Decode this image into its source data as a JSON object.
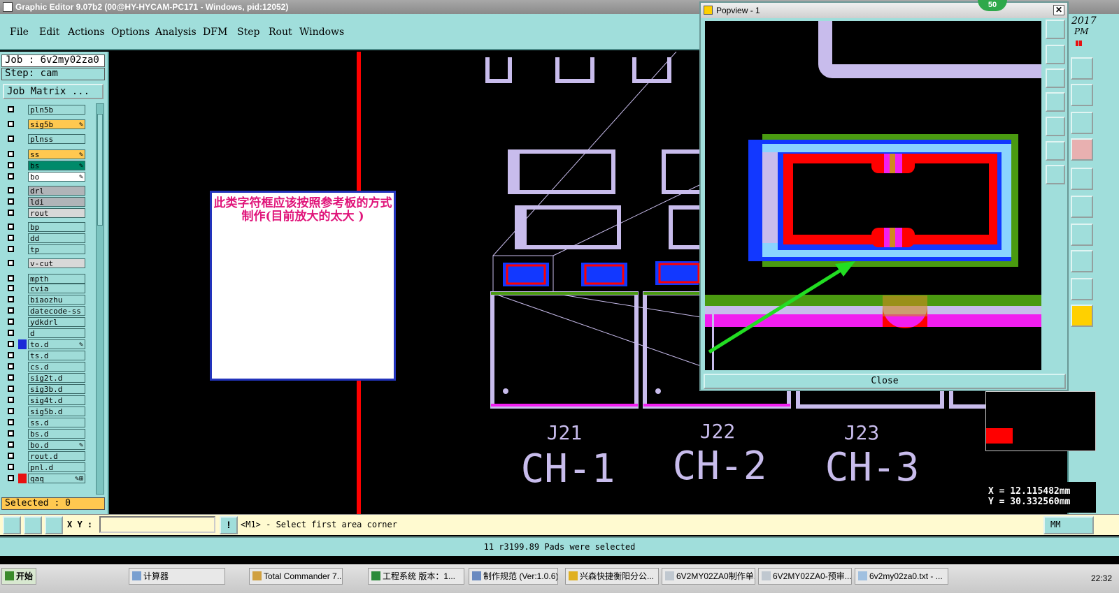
{
  "window": {
    "title": "Graphic Editor 9.07b2 (00@HY-HYCAM-PC171 - Windows, pid:12052)"
  },
  "menu": [
    "File",
    "Edit",
    "Actions",
    "Options",
    "Analysis",
    "DFM",
    "Step",
    "Rout",
    "Windows"
  ],
  "job": {
    "job_label": "Job : 6v2my02za0",
    "step_label": "Step: cam",
    "matrix_button": "Job Matrix ..."
  },
  "layers": [
    {
      "name": "pln5b",
      "color": "#9fdcd8"
    },
    {
      "name": "sig5b",
      "color": "#ffc850",
      "flag": "✎"
    },
    {
      "name": "plnss",
      "color": "#9fdcd8"
    },
    {
      "name": "ss",
      "color": "#ffc850",
      "flag": "✎"
    },
    {
      "name": "bs",
      "color": "#008a6a",
      "flag": "✎"
    },
    {
      "name": "bo",
      "color": "#ffffff",
      "flag": "✎"
    },
    {
      "name": "drl",
      "color": "#b0b4b8"
    },
    {
      "name": "ldi",
      "color": "#b0b4b8"
    },
    {
      "name": "rout",
      "color": "#d8d8d8"
    },
    {
      "name": "bp",
      "color": "#9fdcd8"
    },
    {
      "name": "dd",
      "color": "#9fdcd8"
    },
    {
      "name": "tp",
      "color": "#9fdcd8"
    },
    {
      "name": "v-cut",
      "color": "#d8d8d8"
    },
    {
      "name": "mpth",
      "color": "#9fdcd8"
    },
    {
      "name": "cvia",
      "color": "#9fdcd8"
    },
    {
      "name": "biaozhu",
      "color": "#9fdcd8"
    },
    {
      "name": "datecode-ss",
      "color": "#9fdcd8"
    },
    {
      "name": "ydkdrl",
      "color": "#9fdcd8"
    },
    {
      "name": "d",
      "color": "#9fdcd8"
    },
    {
      "name": "to.d",
      "color": "#9fdcd8",
      "flag": "✎",
      "swatch": "#1a2ad8"
    },
    {
      "name": "ts.d",
      "color": "#9fdcd8"
    },
    {
      "name": "cs.d",
      "color": "#9fdcd8"
    },
    {
      "name": "sig2t.d",
      "color": "#9fdcd8"
    },
    {
      "name": "sig3b.d",
      "color": "#9fdcd8"
    },
    {
      "name": "sig4t.d",
      "color": "#9fdcd8"
    },
    {
      "name": "sig5b.d",
      "color": "#9fdcd8"
    },
    {
      "name": "ss.d",
      "color": "#9fdcd8"
    },
    {
      "name": "bs.d",
      "color": "#9fdcd8"
    },
    {
      "name": "bo.d",
      "color": "#9fdcd8",
      "flag": "✎"
    },
    {
      "name": "rout.d",
      "color": "#9fdcd8"
    },
    {
      "name": "pnl.d",
      "color": "#9fdcd8"
    },
    {
      "name": "qaq",
      "color": "#9fdcd8",
      "flag": "✎⊞",
      "swatch": "#e81010"
    }
  ],
  "selected": "Selected : 0",
  "annotation": {
    "text": "此类字符框应该按照参考板的方式制作(目前放大的太大 )"
  },
  "board_labels": [
    {
      "ref": "J21",
      "ch": "CH-1"
    },
    {
      "ref": "J22",
      "ch": "CH-2"
    },
    {
      "ref": "J23",
      "ch": "CH-3"
    }
  ],
  "popview": {
    "title": "Popview - 1",
    "close": "Close"
  },
  "badge": "50",
  "clock_corner": {
    "year": "2017",
    "ampm": "PM"
  },
  "coords": {
    "x": "X = 12.115482mm",
    "y": "Y = 30.332560mm"
  },
  "units": "MM",
  "xy_label": "X Y :",
  "prompt": "<M1> - Select first area corner",
  "status": "11 r3199.89 Pads were selected",
  "taskbar": {
    "start": "开始",
    "items": [
      "计算器",
      "Total Commander 7....",
      "工程系统  版本：1...",
      "制作规范 (Ver:1.0.6)",
      "兴森快捷衡阳分公...",
      "6V2MY02ZA0制作单...",
      "6V2MY02ZA0-预审...",
      "6v2my02za0.txt - ..."
    ],
    "clock": "22:32"
  },
  "colors": {
    "panel": "#a0dedb",
    "silk": "#c8bcec",
    "red": "#ff0000",
    "green": "#4a9a10",
    "blue": "#1238ff",
    "magenta": "#f21ef0",
    "arrow": "#22dd22"
  }
}
